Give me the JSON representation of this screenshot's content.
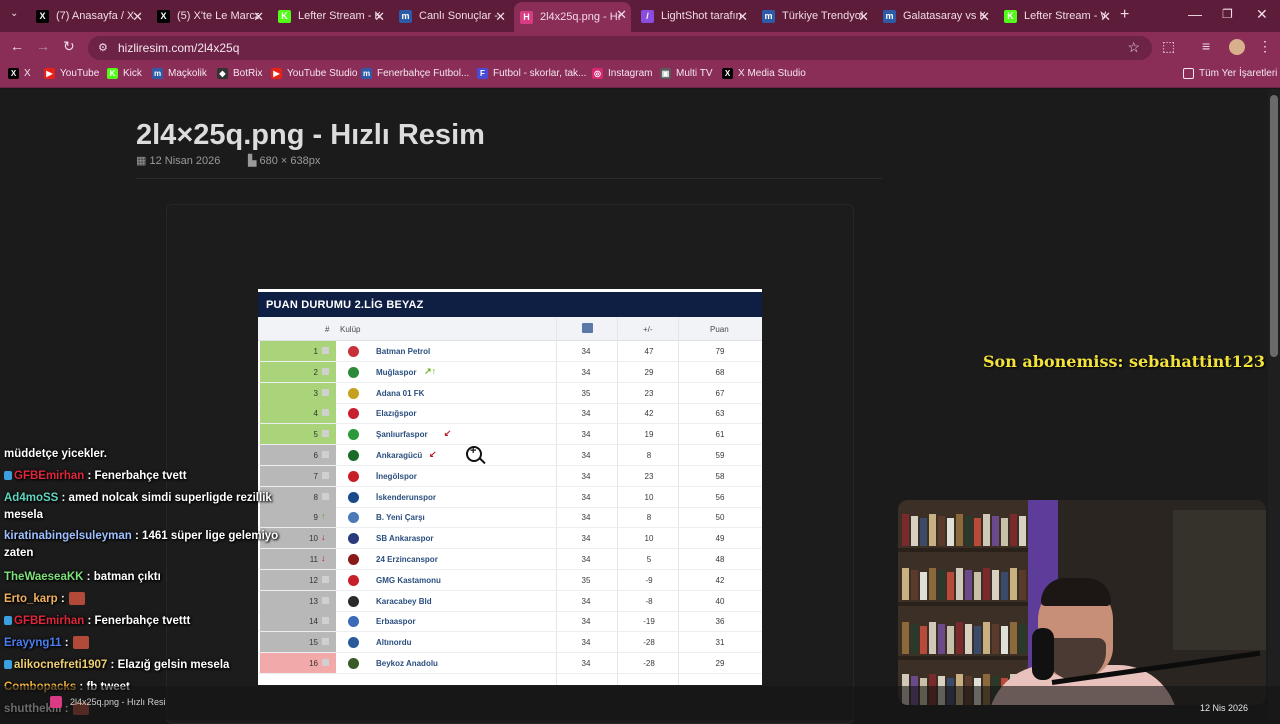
{
  "browser": {
    "tabs": [
      {
        "title": "(7) Anasayfa / X",
        "icon": "x-icon",
        "color": "#000000",
        "glyph": "X",
        "active": false
      },
      {
        "title": "(5) X'te Le Marca",
        "icon": "x-icon",
        "color": "#000000",
        "glyph": "X",
        "active": false
      },
      {
        "title": "Lefter Stream - K",
        "icon": "kick-icon",
        "color": "#53fc18",
        "glyph": "K",
        "active": false
      },
      {
        "title": "Canlı Sonuçlar - ",
        "icon": "mackolik-icon",
        "color": "#2d5ba8",
        "glyph": "m",
        "active": false
      },
      {
        "title": "2l4x25q.png - Hı",
        "icon": "hizliresim-icon",
        "color": "#d93a84",
        "glyph": "H",
        "active": true
      },
      {
        "title": "LightShot tarafın",
        "icon": "lightshot-icon",
        "color": "#8a4de0",
        "glyph": "/",
        "active": false
      },
      {
        "title": "Türkiye Trendyol",
        "icon": "mackolik-icon",
        "color": "#2d5ba8",
        "glyph": "m",
        "active": false
      },
      {
        "title": "Galatasaray vs K",
        "icon": "mackolik-icon",
        "color": "#2d5ba8",
        "glyph": "m",
        "active": false
      },
      {
        "title": "Lefter Stream - W",
        "icon": "kick-icon",
        "color": "#53fc18",
        "glyph": "K",
        "active": false
      }
    ],
    "url": "hizliresim.com/2l4x25q",
    "bookmarks": [
      {
        "label": "X",
        "icon": "x-icon",
        "color": "#000000",
        "glyph": "X"
      },
      {
        "label": "YouTube",
        "icon": "youtube-icon",
        "color": "#e62117",
        "glyph": "▶"
      },
      {
        "label": "Kick",
        "icon": "kick-icon",
        "color": "#53fc18",
        "glyph": "K"
      },
      {
        "label": "Maçkolik",
        "icon": "mackolik-icon",
        "color": "#2d5ba8",
        "glyph": "m"
      },
      {
        "label": "BotRix",
        "icon": "botrix-icon",
        "color": "#333333",
        "glyph": "◆"
      },
      {
        "label": "YouTube Studio",
        "icon": "youtube-studio-icon",
        "color": "#e62117",
        "glyph": "▶"
      },
      {
        "label": "Fenerbahçe Futbol...",
        "icon": "mackolik-icon",
        "color": "#2d5ba8",
        "glyph": "m"
      },
      {
        "label": "Futbol - skorlar, tak...",
        "icon": "flashscore-icon",
        "color": "#4a4ad8",
        "glyph": "F"
      },
      {
        "label": "Instagram",
        "icon": "instagram-icon",
        "color": "#d6296f",
        "glyph": "◎"
      },
      {
        "label": "Multi TV",
        "icon": "multitv-icon",
        "color": "#5a5a5a",
        "glyph": "▣"
      },
      {
        "label": "X Media Studio",
        "icon": "x-icon",
        "color": "#000000",
        "glyph": "X"
      }
    ],
    "all_bookmarks": "Tüm Yer İşaretleri"
  },
  "page": {
    "title": "2l4×25q.png - Hızlı Resim",
    "date": "12 Nisan 2026",
    "dimensions": "680 × 638px"
  },
  "standings": {
    "title": "PUAN DURUMU 2.LİG BEYAZ",
    "columns": {
      "pos": "#",
      "club": "Kulüp",
      "played_icon": "calendar-icon",
      "diff": "+/-",
      "points": "Puan"
    },
    "rows": [
      {
        "pos": "1",
        "team": "Batman Petrol",
        "played": "34",
        "diff": "47",
        "points": "79",
        "zone": "promotion",
        "trend": "",
        "mark": ""
      },
      {
        "pos": "2",
        "team": "Muğlaspor",
        "played": "34",
        "diff": "29",
        "points": "68",
        "zone": "promotion",
        "trend": "",
        "mark": "↗↑"
      },
      {
        "pos": "3",
        "team": "Adana 01 FK",
        "played": "35",
        "diff": "23",
        "points": "67",
        "zone": "promotion",
        "trend": "",
        "mark": ""
      },
      {
        "pos": "4",
        "team": "Elazığspor",
        "played": "34",
        "diff": "42",
        "points": "63",
        "zone": "promotion",
        "trend": "",
        "mark": ""
      },
      {
        "pos": "5",
        "team": "Şanlıurfaspor",
        "played": "34",
        "diff": "19",
        "points": "61",
        "zone": "promotion",
        "trend": "",
        "mark": "↙"
      },
      {
        "pos": "6",
        "team": "Ankaragücü",
        "played": "34",
        "diff": "8",
        "points": "59",
        "zone": "grey",
        "trend": "",
        "mark": "↙"
      },
      {
        "pos": "7",
        "team": "İnegölspor",
        "played": "34",
        "diff": "23",
        "points": "58",
        "zone": "grey",
        "trend": "",
        "mark": ""
      },
      {
        "pos": "8",
        "team": "İskenderunspor",
        "played": "34",
        "diff": "10",
        "points": "56",
        "zone": "grey",
        "trend": "",
        "mark": ""
      },
      {
        "pos": "9",
        "team": "B. Yeni Çarşı",
        "played": "34",
        "diff": "8",
        "points": "50",
        "zone": "grey",
        "trend": "up",
        "mark": ""
      },
      {
        "pos": "10",
        "team": "SB Ankaraspor",
        "played": "34",
        "diff": "10",
        "points": "49",
        "zone": "grey",
        "trend": "down",
        "mark": ""
      },
      {
        "pos": "11",
        "team": "24 Erzincanspor",
        "played": "34",
        "diff": "5",
        "points": "48",
        "zone": "grey",
        "trend": "down",
        "mark": ""
      },
      {
        "pos": "12",
        "team": "GMG Kastamonu",
        "played": "35",
        "diff": "-9",
        "points": "42",
        "zone": "grey",
        "trend": "",
        "mark": ""
      },
      {
        "pos": "13",
        "team": "Karacabey Bld",
        "played": "34",
        "diff": "-8",
        "points": "40",
        "zone": "grey",
        "trend": "",
        "mark": ""
      },
      {
        "pos": "14",
        "team": "Erbaaspor",
        "played": "34",
        "diff": "-19",
        "points": "36",
        "zone": "grey",
        "trend": "",
        "mark": ""
      },
      {
        "pos": "15",
        "team": "Altınordu",
        "played": "34",
        "diff": "-28",
        "points": "31",
        "zone": "grey",
        "trend": "",
        "mark": ""
      },
      {
        "pos": "16",
        "team": "Beykoz Anadolu",
        "played": "34",
        "diff": "-28",
        "points": "29",
        "zone": "relegation",
        "trend": "",
        "mark": ""
      }
    ]
  },
  "chat": [
    {
      "user": "",
      "text": "müddetçe yicekler.",
      "user_color": "#ffffff"
    },
    {
      "user": "GFBEmirhan",
      "text": " : Fenerbahçe tvett",
      "user_color": "#e0263a",
      "badge": true
    },
    {
      "user": "Ad4moSS",
      "text": " : amed nolcak simdi superligde rezillik mesela",
      "user_color": "#5fd6c0"
    },
    {
      "user": "kiratinabingelsuleyman",
      "text": " : 1461 süper lige gelemiyo zaten",
      "user_color": "#9fc0ff"
    },
    {
      "user": "TheWaeseaKK",
      "text": " : batman çıktı",
      "user_color": "#7de07a"
    },
    {
      "user": "Erto_karp",
      "text": " :",
      "user_color": "#f0b060",
      "emote": true
    },
    {
      "user": "GFBEmirhan",
      "text": " : Fenerbahçe tvettt",
      "user_color": "#e0263a",
      "badge": true
    },
    {
      "user": "Erayyng11",
      "text": " :",
      "user_color": "#4a7ef0",
      "emote": true
    },
    {
      "user": "alikocnefreti1907",
      "text": " : Elazığ gelsin mesela",
      "user_color": "#f0d070",
      "badge": true
    },
    {
      "user": "Combopacks",
      "text": " : fb tweet",
      "user_color": "#f0b040"
    },
    {
      "user": "shutthekill",
      "text": " :",
      "user_color": "#e8e8e8",
      "emote": true
    }
  ],
  "overlay": {
    "subscriber": "Son abonemiss: sebahattint123"
  },
  "taskbar": {
    "download_title": "2l4x25q.png - Hızlı Resi",
    "clock": "12 Nis 2026"
  },
  "colors": {
    "promotion": "#a9d47a",
    "grey": "#b8b8b8",
    "relegation": "#f2a9a9",
    "up": "#5a9e2a",
    "down": "#b8202a"
  }
}
